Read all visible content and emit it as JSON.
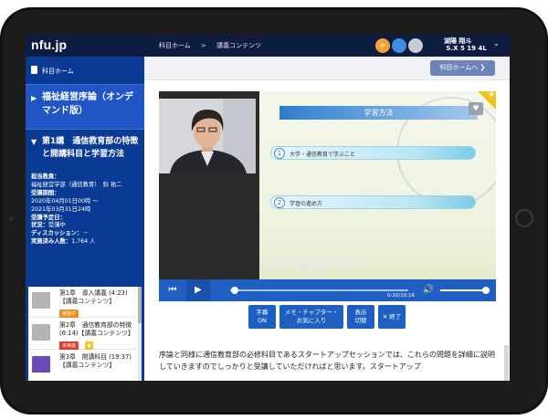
{
  "app": {
    "logo": "nfu.jp"
  },
  "header": {
    "breadcrumb": [
      "科目ホーム",
      ">",
      "講義コンテンツ"
    ],
    "avatar_labels": [
      "ip",
      "",
      ""
    ],
    "user_name": "湖陽 翔斗 \n S.X 5 19 4L"
  },
  "sidebar": {
    "home_label": "科目ホーム",
    "course_title": "福祉経営序論（オンデマンド版）",
    "lecture_title": "第1講　通信教育部の特徴と開講科目と学習方法",
    "info": [
      {
        "k": "担当教員：",
        "v": ""
      },
      {
        "k": "",
        "v": "福祉経営学部（通信教育）　鈴 祐二"
      },
      {
        "k": "受講期間：",
        "v": ""
      },
      {
        "k": "",
        "v": "2020年04月01日00時 ～"
      },
      {
        "k": "",
        "v": "2021年03月31日24時"
      },
      {
        "k": "受講予定日：",
        "v": ""
      },
      {
        "k": "状況：",
        "v": "受講中"
      },
      {
        "k": "ディスカッション：",
        "v": "－"
      },
      {
        "k": "実施済み人数：",
        "v": "1,764 人"
      }
    ],
    "chapters": [
      {
        "title": "第1章　導入講義 (4:23)【講義コンテンツ】",
        "badge": "実施中",
        "badge_type": "done"
      },
      {
        "title": "第2章　通信教育部の特徴 (6:14)【講義コンテンツ】",
        "badge": "未実施",
        "badge_type": "todo"
      },
      {
        "title": "第3章　開講科目 (19:37)【講義コンテンツ】",
        "badge": "",
        "badge_type": ""
      }
    ]
  },
  "main": {
    "back_button": "科目ホームへ ❯",
    "slide": {
      "title": "学習方法",
      "items": [
        {
          "num": "1",
          "label": "大学・通信教育で学ぶこと"
        },
        {
          "num": "2",
          "label": "学習の進め方"
        }
      ],
      "watermark": "日本福祉大学"
    },
    "player": {
      "time": "0:20/10:16",
      "buttons": {
        "subtitle": "字幕\nON",
        "memo": "メモ・チャプター・\nお気に入り",
        "display": "表示\n切替",
        "exit": "✕ 終了"
      }
    },
    "description": "序論と同様に通信教育部の必修科目であるスタートアップセッションでは、これらの問題を詳細に説明していきますのでしっかりと受講していただければと思います。スタートアップ"
  }
}
